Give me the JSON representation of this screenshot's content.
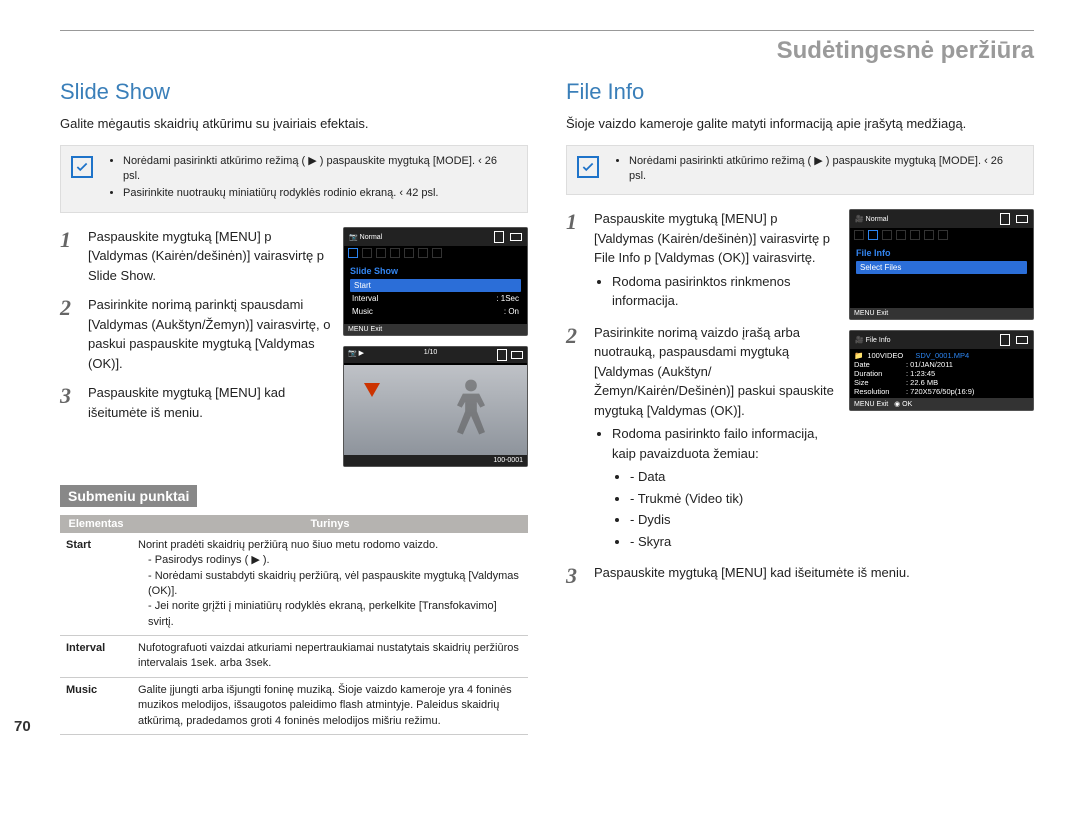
{
  "super_title": "Sudėtingesnė peržiūra",
  "page_number": "70",
  "left": {
    "title": "Slide Show",
    "intro": "Galite mėgautis skaidrių atkūrimu su įvairiais efektais.",
    "note_items": [
      "Norėdami pasirinkti atkūrimo režimą ( ▶ ) paspauskite mygtuką [MODE]. ‹ 26 psl.",
      "Pasirinkite nuotraukų miniatiūrų rodyklės rodinio ekraną. ‹ 42 psl."
    ],
    "step1": "Paspauskite mygtuką [MENU] p [Valdymas (Kairėn/dešinėn)] vairasvirtę p Slide Show.",
    "step2": "Pasirinkite norimą parinktį spausdami [Valdymas (Aukštyn/Žemyn)] vairasvirtę, o paskui paspauskite mygtuką [Valdymas (OK)].",
    "step3": "Paspauskite mygtuką [MENU] kad išeitumėte iš meniu.",
    "sub_title": "Submeniu punktai",
    "table": {
      "head_el": "Elementas",
      "head_tu": "Turinys",
      "rows": [
        {
          "name": "Start",
          "desc": "Norint pradėti skaidrių peržiūrą nuo šiuo metu rodomo vaizdo.",
          "bullets": [
            "Pasirodys rodinys ( ▶ ).",
            "Norėdami sustabdyti skaidrių peržiūrą, vėl paspauskite mygtuką [Valdymas (OK)].",
            "Jei norite grįžti į miniatiūrų rodyklės ekraną, perkelkite [Transfokavimo] svirtį."
          ]
        },
        {
          "name": "Interval",
          "desc": "Nufotografuoti vaizdai atkuriami nepertraukiamai nustatytais skaidrių peržiūros intervalais 1sek. arba 3sek."
        },
        {
          "name": "Music",
          "desc": "Galite įjungti arba išjungti foninę muziką. Šioje vaizdo kameroje yra 4 foninės muzikos melodijos, išsaugotos paleidimo flash atmintyje. Paleidus skaidrių atkūrimą, pradedamos groti 4 foninės melodijos mišriu režimu."
        }
      ]
    },
    "screen1": {
      "header_left": "Normal",
      "menu_title": "Slide Show",
      "rows": [
        {
          "label": "Start",
          "val": ""
        },
        {
          "label": "Interval",
          "val": ": 1Sec"
        },
        {
          "label": "Music",
          "val": ": On"
        }
      ],
      "exit": "MENU Exit"
    },
    "screen2": {
      "counter": "1/10",
      "file": "100-0001"
    }
  },
  "right": {
    "title": "File Info",
    "intro": "Šioje vaizdo kameroje galite matyti informaciją apie įrašytą medžiagą.",
    "note_items": [
      "Norėdami pasirinkti atkūrimo režimą ( ▶ ) paspauskite mygtuką [MODE]. ‹ 26 psl."
    ],
    "step1": "Paspauskite mygtuką [MENU] p [Valdymas (Kairėn/dešinėn)] vairasvirtę p File Info p [Valdymas (OK)] vairasvirtę.",
    "step1_b": "Rodoma pasirinktos rinkmenos informacija.",
    "step2": "Pasirinkite norimą vaizdo įrašą arba nuotrauką, paspausdami mygtuką [Valdymas (Aukštyn/Žemyn/Kairėn/Dešinėn)] paskui spauskite mygtuką [Valdymas (OK)].",
    "step2_b": "Rodoma pasirinkto failo informacija, kaip pavaizduota žemiau:",
    "step2_list": [
      "Data",
      "Trukmė (Video tik)",
      "Dydis",
      "Skyra"
    ],
    "step3": "Paspauskite mygtuką [MENU] kad išeitumėte iš meniu.",
    "screen1": {
      "header_left": "Normal",
      "menu_title": "File Info",
      "row": "Select Files",
      "exit": "MENU Exit"
    },
    "screen2": {
      "header_left": "File Info",
      "folder": "100VIDEO",
      "file": "SDV_0001.MP4",
      "details": [
        {
          "lbl": "Date",
          "val": ": 01/JAN/2011"
        },
        {
          "lbl": "Duration",
          "val": ": 1:23:45"
        },
        {
          "lbl": "Size",
          "val": ": 22.6 MB"
        },
        {
          "lbl": "Resolution",
          "val": ": 720X576/50p(16:9)"
        }
      ],
      "exit": "MENU Exit",
      "ok": "OK"
    }
  }
}
